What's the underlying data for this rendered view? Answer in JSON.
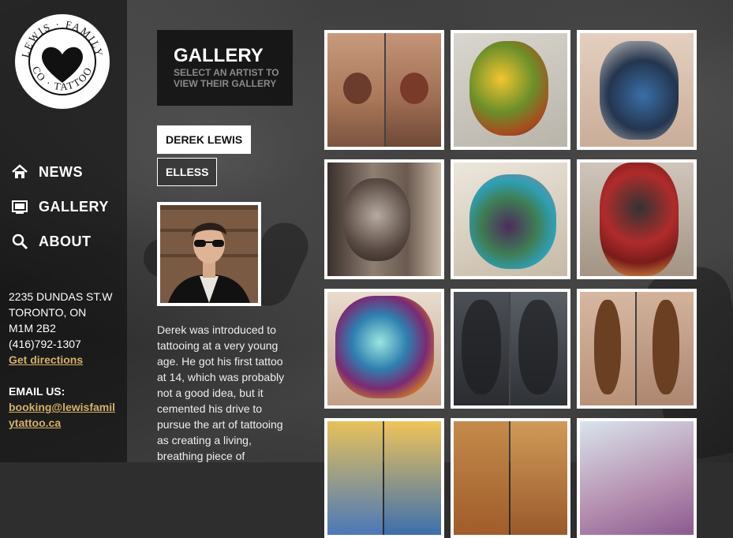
{
  "brand": {
    "logo_text": "LEWIS · FAMILY · TATTOO · CO"
  },
  "nav": [
    {
      "label": "NEWS",
      "icon": "home-icon"
    },
    {
      "label": "GALLERY",
      "icon": "monitor-icon"
    },
    {
      "label": "ABOUT",
      "icon": "search-icon"
    }
  ],
  "contact": {
    "address1": "2235 DUNDAS ST.W",
    "address2": "TORONTO, ON",
    "postal": "M1M 2B2",
    "phone": "(416)792-1307",
    "directions": "Get directions",
    "email_heading": "EMAIL US:",
    "email": "booking@lewisfamilytattoo.ca"
  },
  "gallery": {
    "title": "GALLERY",
    "subtitle": "SELECT AN ARTIST TO VIEW THEIR GALLERY"
  },
  "artists": [
    {
      "name": "DEREK LEWIS",
      "active": true
    },
    {
      "name": "ELLESS",
      "active": false
    }
  ],
  "bio": "Derek was introduced to tattooing at a very young age. He got his first tattoo at 14, which was probably not a good idea, but it cemented his drive to pursue the art of tattooing as creating a living, breathing piece of",
  "colors": {
    "accent_link": "#d6b06a",
    "sidebar_bg": "#0a0a0a"
  }
}
